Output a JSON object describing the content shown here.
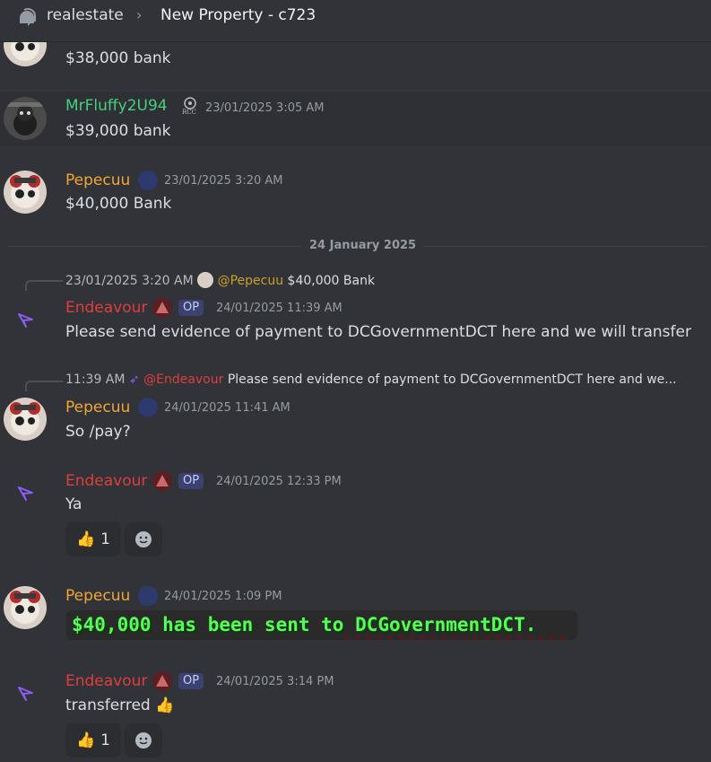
{
  "header": {
    "channel": "realestate",
    "separator": "›",
    "thread": "New Property - c723"
  },
  "divider_label": "24 January 2025",
  "colors": {
    "background": "#313338",
    "name_pepecuu": "#f0a732",
    "name_mrfluffy": "#43d17a",
    "name_endeavour": "#e03d3d",
    "op_badge": "#3c4270"
  },
  "messages": {
    "m0": {
      "text": "$38,000 bank"
    },
    "m1": {
      "author": "MrFluffy2U94",
      "badge_text": "RCC",
      "timestamp": "23/01/2025 3:05 AM",
      "text": "$39,000 bank"
    },
    "m2": {
      "author": "Pepecuu",
      "timestamp": "23/01/2025 3:20 AM",
      "text": "$40,000 Bank"
    },
    "m3": {
      "reply": {
        "time": "23/01/2025 3:20 AM",
        "mention": "@Pepecuu",
        "text": "$40,000 Bank"
      },
      "author": "Endeavour",
      "op": "OP",
      "timestamp": "24/01/2025 11:39 AM",
      "text": "Please send evidence of payment to DCGovernmentDCT here and we will transfer"
    },
    "m4": {
      "reply": {
        "time": "11:39 AM",
        "mention": "@Endeavour",
        "text": "Please send evidence of payment to DCGovernmentDCT here and we..."
      },
      "author": "Pepecuu",
      "timestamp": "24/01/2025 11:41 AM",
      "text": "So /pay?"
    },
    "m5": {
      "author": "Endeavour",
      "op": "OP",
      "timestamp": "24/01/2025 12:33 PM",
      "text": "Ya",
      "reaction": {
        "emoji": "👍",
        "count": "1"
      }
    },
    "m6": {
      "author": "Pepecuu",
      "timestamp": "24/01/2025 1:09 PM",
      "image_text": "$40,000 has been sent to DCGovernmentDCT."
    },
    "m7": {
      "author": "Endeavour",
      "op": "OP",
      "timestamp": "24/01/2025 3:14 PM",
      "text": "transferred",
      "inline_emoji": "👍",
      "reaction": {
        "emoji": "👍",
        "count": "1"
      }
    }
  },
  "icons": {
    "add_reaction": "smile-plus-icon",
    "thread": "thread-icon"
  }
}
